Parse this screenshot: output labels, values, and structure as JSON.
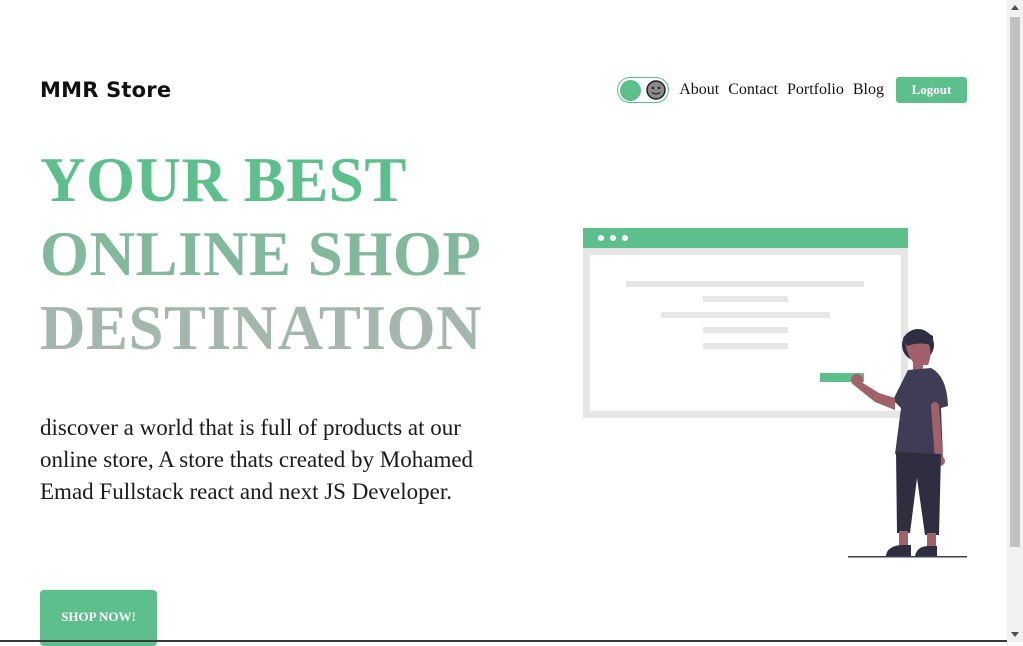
{
  "header": {
    "brand": "MMR Store",
    "nav": [
      "About",
      "Contact",
      "Portfolio",
      "Blog"
    ],
    "logout_label": "Logout",
    "theme_toggle_icon": "moon-face-icon"
  },
  "hero": {
    "title_lines": [
      "YOUR BEST",
      "ONLINE SHOP",
      "DESTINATION"
    ],
    "description": "discover a world that is full of products at our online store, A store thats created by Mohamed Emad Fullstack react and next JS Developer.",
    "cta_label": "SHOP NOW!"
  },
  "colors": {
    "accent": "#5cbf8c",
    "title_line2": "#82b99c",
    "title_line3": "#a3b7ad"
  }
}
